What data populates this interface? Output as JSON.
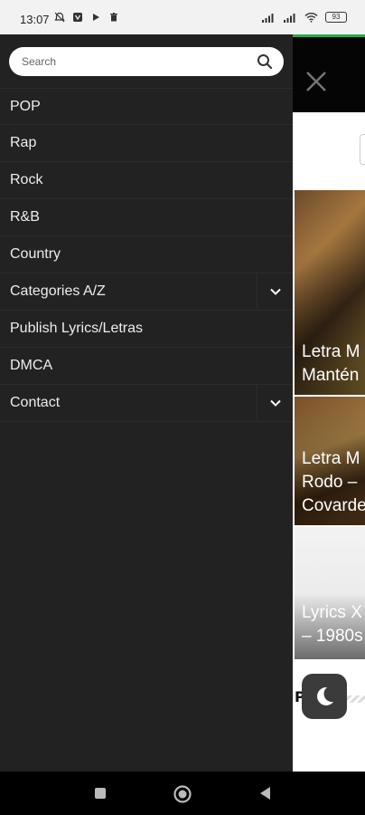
{
  "status_bar": {
    "time": "13:07",
    "battery": "93"
  },
  "search": {
    "placeholder": "Search"
  },
  "menu": {
    "items": [
      {
        "label": "POP"
      },
      {
        "label": "Rap"
      },
      {
        "label": "Rock"
      },
      {
        "label": "R&B"
      },
      {
        "label": "Country"
      },
      {
        "label": "Categories A/Z"
      },
      {
        "label": "Publish Lyrics/Letras"
      },
      {
        "label": "DMCA"
      },
      {
        "label": "Contact"
      }
    ]
  },
  "background": {
    "cards": [
      {
        "line1": "Letra M",
        "line2": "Mantén"
      },
      {
        "line1": "Letra M",
        "line2": "Rodo –",
        "line3": "Covarde"
      },
      {
        "line1": "Lyrics X",
        "line2": "– 1980s"
      }
    ],
    "section_tag": "POP"
  },
  "colors": {
    "drawer_bg": "#222222",
    "accent": "#2fa84f",
    "header_bg": "#050505"
  }
}
